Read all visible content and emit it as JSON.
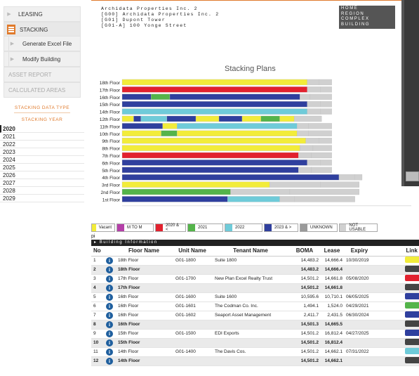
{
  "sidebar": {
    "leasing": "LEASING",
    "stacking": "STACKING",
    "generate_excel": "Generate Excel File",
    "modify_building": "Modify Building",
    "asset_report": "ASSET REPORT",
    "calculated_areas": "CALCULATED AREAS",
    "stacking_data_type": "STACKING DATA TYPE",
    "stacking_year": "STACKING YEAR",
    "years": [
      "2020",
      "2021",
      "2022",
      "2023",
      "2024",
      "2025",
      "2026",
      "2027",
      "2028",
      "2029"
    ],
    "selected_year": "2020"
  },
  "header": {
    "line1": "Archidata Properties Inc. 2",
    "line2": "[G00] Archidata Properties Inc. 2",
    "line3": "[G01] Dupont Tower",
    "line4": "[G01-A] 100 Yonge Street",
    "nav": [
      "HOME",
      "REGION",
      "COMPLEX",
      "BUILDING"
    ]
  },
  "colors": {
    "vacant": "#f2ec3a",
    "mtom": "#b43fa8",
    "y2020": "#e2212e",
    "y2021": "#54b44a",
    "y2022": "#6fcbd9",
    "y2023": "#2f3f9e",
    "unknown": "#9a9a9a",
    "notusable": "#d0d0d0"
  },
  "chart_data": {
    "type": "bar",
    "title": "Stacking Plans",
    "floors": [
      "18th Floor",
      "17th Floor",
      "16th Floor",
      "15th Floor",
      "14th Floor",
      "12th Floor",
      "11th Floor",
      "10th Floor",
      "9th Floor",
      "8th Floor",
      "7th Floor",
      "6th Floor",
      "5th Floor",
      "4th Floor",
      "3rd Floor",
      "2nd Floor",
      "1st Floor"
    ],
    "xticks": [
      "0",
      "5000",
      "10000",
      "15000",
      "20000"
    ],
    "xlim": [
      0,
      20000
    ],
    "stacks": [
      [
        [
          "vacant",
          12800
        ],
        [
          "notusable",
          800
        ],
        [
          "notusable",
          900
        ]
      ],
      [
        [
          "y2020",
          12800
        ],
        [
          "notusable",
          900
        ],
        [
          "notusable",
          800
        ]
      ],
      [
        [
          "y2023",
          2000
        ],
        [
          "y2021",
          1300
        ],
        [
          "y2023",
          9000
        ],
        [
          "notusable",
          700
        ],
        [
          "notusable",
          1500
        ]
      ],
      [
        [
          "y2023",
          12800
        ],
        [
          "notusable",
          900
        ],
        [
          "notusable",
          800
        ]
      ],
      [
        [
          "y2022",
          12800
        ],
        [
          "notusable",
          900
        ],
        [
          "notusable",
          800
        ]
      ],
      [
        [
          "vacant",
          800
        ],
        [
          "y2023",
          500
        ],
        [
          "y2022",
          1800
        ],
        [
          "y2023",
          2000
        ],
        [
          "vacant",
          1600
        ],
        [
          "y2023",
          1600
        ],
        [
          "vacant",
          1300
        ],
        [
          "y2021",
          1300
        ],
        [
          "vacant",
          1000
        ],
        [
          "notusable",
          1900
        ]
      ],
      [
        [
          "y2023",
          2800
        ],
        [
          "vacant",
          1000
        ],
        [
          "y2022",
          8300
        ],
        [
          "notusable",
          800
        ],
        [
          "notusable",
          1600
        ]
      ],
      [
        [
          "vacant",
          2700
        ],
        [
          "y2021",
          1100
        ],
        [
          "vacant",
          8300
        ],
        [
          "notusable",
          800
        ],
        [
          "notusable",
          1600
        ]
      ],
      [
        [
          "vacant",
          12700
        ],
        [
          "notusable",
          900
        ],
        [
          "notusable",
          900
        ]
      ],
      [
        [
          "vacant",
          12300
        ],
        [
          "notusable",
          900
        ],
        [
          "notusable",
          1300
        ]
      ],
      [
        [
          "y2020",
          12200
        ],
        [
          "notusable",
          900
        ],
        [
          "notusable",
          1400
        ]
      ],
      [
        [
          "y2023",
          12800
        ],
        [
          "notusable",
          900
        ],
        [
          "notusable",
          800
        ]
      ],
      [
        [
          "y2023",
          12200
        ],
        [
          "notusable",
          900
        ],
        [
          "notusable",
          1400
        ]
      ],
      [
        [
          "y2023",
          15000
        ],
        [
          "notusable",
          1100
        ],
        [
          "notusable",
          500
        ]
      ],
      [
        [
          "vacant",
          10200
        ],
        [
          "notusable",
          3500
        ],
        [
          "notusable",
          2700
        ]
      ],
      [
        [
          "y2021",
          7500
        ],
        [
          "notusable",
          4100
        ],
        [
          "notusable",
          4800
        ]
      ],
      [
        [
          "y2023",
          7300
        ],
        [
          "y2022",
          3600
        ],
        [
          "notusable",
          1000
        ],
        [
          "notusable",
          4200
        ]
      ]
    ]
  },
  "legend": [
    {
      "label": "Vacant",
      "color": "#f2ec3a"
    },
    {
      "label": "M TO M",
      "color": "#b43fa8"
    },
    {
      "label": "2020 & <",
      "color": "#e2212e"
    },
    {
      "label": "2021",
      "color": "#54b44a"
    },
    {
      "label": "2022",
      "color": "#6fcbd9"
    },
    {
      "label": "2023 & >",
      "color": "#2f3f9e"
    },
    {
      "label": "UNKNOWN",
      "color": "#9a9a9a"
    },
    {
      "label": "NOT USABLE",
      "color": "#d0d0d0"
    }
  ],
  "pi": "pi",
  "building_info": "Building Information",
  "table": {
    "headers": [
      "No",
      "",
      "Floor Name",
      "Unit Name",
      "Tenant Name",
      "BOMA",
      "Lease",
      "Expiry",
      "Link"
    ],
    "rows": [
      {
        "no": "1",
        "floor": "18th Floor",
        "unit": "G01-1800",
        "tenant": "Suite 1800",
        "boma": "14,483.2",
        "lease": "14,666.4",
        "expiry": "10/30/2019",
        "bold": false,
        "link": "#f2ec3a"
      },
      {
        "no": "2",
        "floor": "18th Floor",
        "unit": "",
        "tenant": "",
        "boma": "14,483.2",
        "lease": "14,666.4",
        "expiry": "",
        "bold": true,
        "link": "#444"
      },
      {
        "no": "3",
        "floor": "17th Floor",
        "unit": "G01-1700",
        "tenant": "New Plan Excel Realty Trust",
        "boma": "14,501.2",
        "lease": "14,661.8",
        "expiry": "05/08/2020",
        "bold": false,
        "link": "#e2212e"
      },
      {
        "no": "4",
        "floor": "17th Floor",
        "unit": "",
        "tenant": "",
        "boma": "14,501.2",
        "lease": "14,661.8",
        "expiry": "",
        "bold": true,
        "link": "#444"
      },
      {
        "no": "5",
        "floor": "16th Floor",
        "unit": "G01-1600",
        "tenant": "Suite 1600",
        "boma": "10,595.6",
        "lease": "10,710.1",
        "expiry": "06/05/2025",
        "bold": false,
        "link": "#2f3f9e"
      },
      {
        "no": "6",
        "floor": "16th Floor",
        "unit": "G01-1601",
        "tenant": "The Codman Co. Inc.",
        "boma": "1,494.1",
        "lease": "1,524.0",
        "expiry": "04/29/2021",
        "bold": false,
        "link": "#54b44a"
      },
      {
        "no": "7",
        "floor": "16th Floor",
        "unit": "G01-1602",
        "tenant": "Seaport Asset Management",
        "boma": "2,411.7",
        "lease": "2,431.5",
        "expiry": "06/30/2024",
        "bold": false,
        "link": "#2f3f9e"
      },
      {
        "no": "8",
        "floor": "16th Floor",
        "unit": "",
        "tenant": "",
        "boma": "14,501.3",
        "lease": "14,665.5",
        "expiry": "",
        "bold": true,
        "link": "#444"
      },
      {
        "no": "9",
        "floor": "15th Floor",
        "unit": "G01-1500",
        "tenant": "EDI Exports",
        "boma": "14,501.2",
        "lease": "16,812.4",
        "expiry": "04/27/2025",
        "bold": false,
        "link": "#2f3f9e"
      },
      {
        "no": "10",
        "floor": "15th Floor",
        "unit": "",
        "tenant": "",
        "boma": "14,501.2",
        "lease": "16,812.4",
        "expiry": "",
        "bold": true,
        "link": "#444"
      },
      {
        "no": "11",
        "floor": "14th Floor",
        "unit": "G01-1400",
        "tenant": "The Davis Cos.",
        "boma": "14,501.2",
        "lease": "14,662.1",
        "expiry": "07/31/2022",
        "bold": false,
        "link": "#6fcbd9"
      },
      {
        "no": "12",
        "floor": "14th Floor",
        "unit": "",
        "tenant": "",
        "boma": "14,501.2",
        "lease": "14,662.1",
        "expiry": "",
        "bold": true,
        "link": "#444"
      }
    ]
  }
}
